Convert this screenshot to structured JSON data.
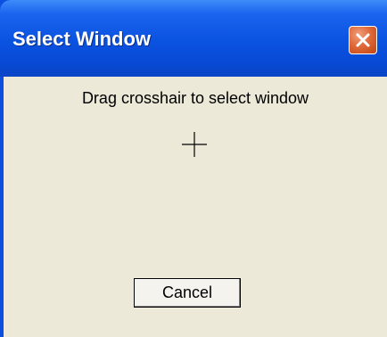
{
  "window": {
    "title": "Select Window",
    "close_icon": "close-icon"
  },
  "content": {
    "message": "Drag crosshair to select window",
    "crosshair_icon": "crosshair-icon",
    "cancel_label": "Cancel"
  },
  "colors": {
    "titlebar": "#0a52e0",
    "close_button": "#e06a3a",
    "client_background": "#ece9d8"
  }
}
